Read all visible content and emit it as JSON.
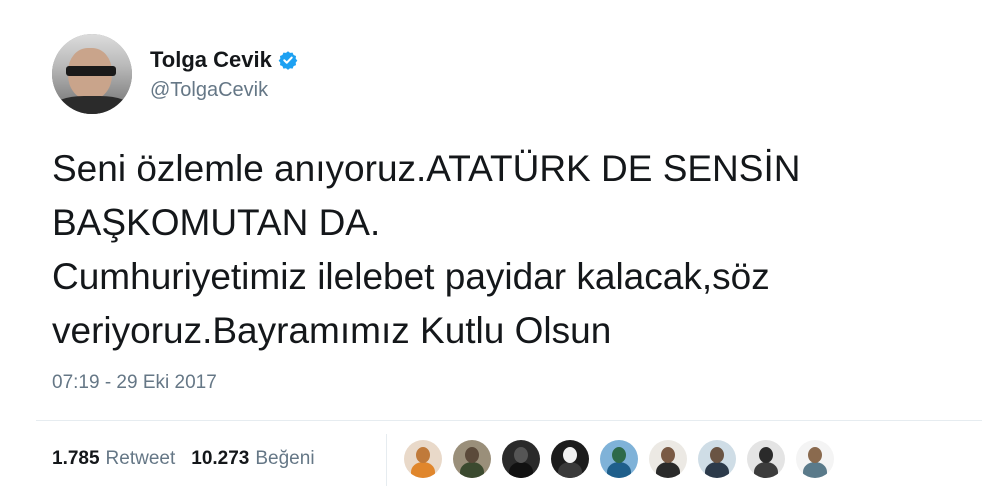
{
  "user": {
    "display_name": "Tolga Cevik",
    "handle": "@TolgaCevik",
    "verified": true,
    "verified_color": "#1da1f2"
  },
  "tweet": {
    "lines": [
      "Seni özlemle anıyoruz.ATATÜRK DE SENSİN",
      "BAŞKOMUTAN DA.",
      "Cumhuriyetimiz ilelebet payidar kalacak,söz",
      "veriyoruz.Bayramımız Kutlu Olsun"
    ],
    "timestamp": "07:19 - 29 Eki 2017"
  },
  "stats": {
    "retweets_count": "1.785",
    "retweets_label": "Retweet",
    "likes_count": "10.273",
    "likes_label": "Beğeni"
  },
  "likers": [
    {
      "icon": "liker-avatar-1",
      "bg": "#e9d9c9",
      "head": "#c07a3a",
      "body": "#e0862c"
    },
    {
      "icon": "liker-avatar-2",
      "bg": "#9a8f7a",
      "head": "#5b4a3a",
      "body": "#3b4a2f"
    },
    {
      "icon": "liker-avatar-3",
      "bg": "#2a2a2a",
      "head": "#555555",
      "body": "#111111"
    },
    {
      "icon": "liker-avatar-4",
      "bg": "#1c1c1c",
      "head": "#f2f2f2",
      "body": "#3a3a3a"
    },
    {
      "icon": "liker-avatar-5",
      "bg": "#7fb2d8",
      "head": "#2e6a4a",
      "body": "#1f5f8b"
    },
    {
      "icon": "liker-avatar-6",
      "bg": "#ece9e4",
      "head": "#7a5a44",
      "body": "#2a2a2a"
    },
    {
      "icon": "liker-avatar-7",
      "bg": "#cfdde6",
      "head": "#6a5443",
      "body": "#2c3a4a"
    },
    {
      "icon": "liker-avatar-8",
      "bg": "#e4e4e4",
      "head": "#2a2a2a",
      "body": "#3c3c3c"
    },
    {
      "icon": "liker-avatar-9",
      "bg": "#f4f4f4",
      "head": "#8a6a4e",
      "body": "#5a7a8a"
    }
  ],
  "colors": {
    "text": "#14171a",
    "secondary_text": "#657786",
    "divider": "#e6ecf0"
  }
}
